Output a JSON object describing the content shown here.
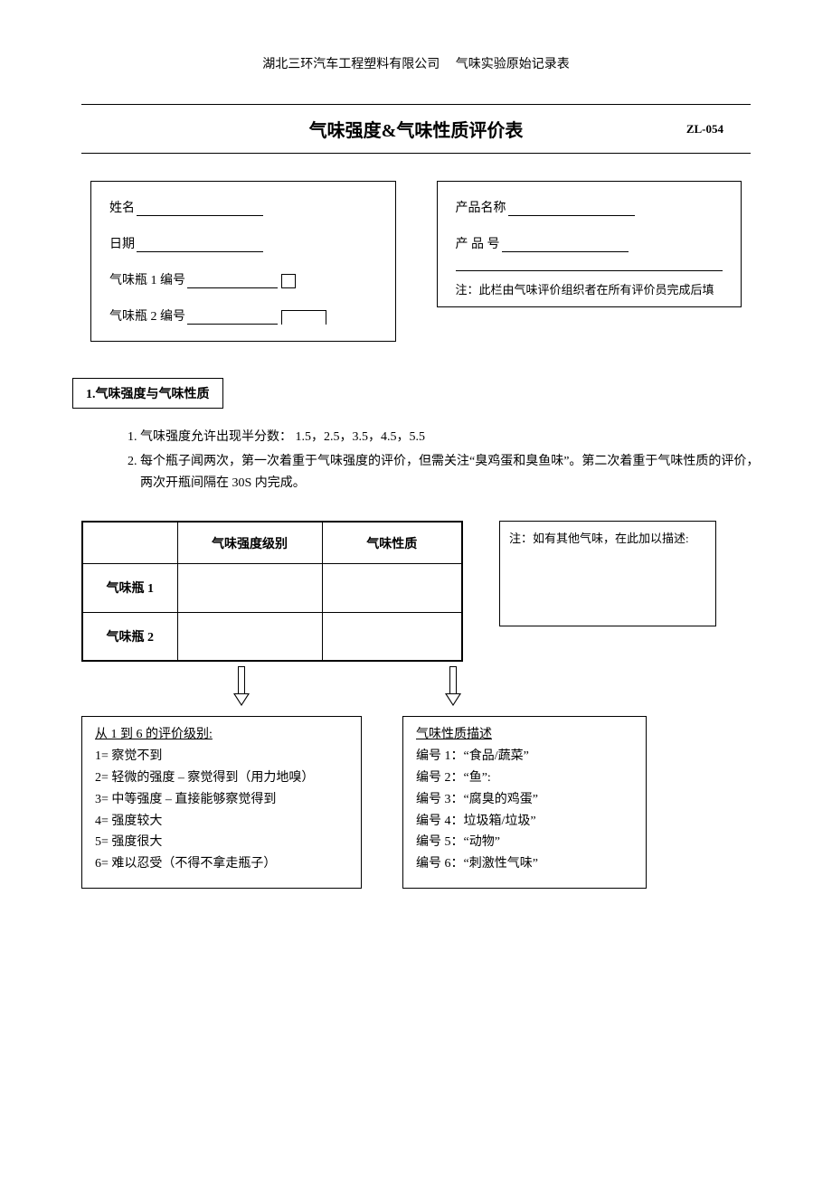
{
  "header": {
    "company": "湖北三环汽车工程塑料有限公司",
    "doc": "气味实验原始记录表"
  },
  "title": {
    "main": "气味强度&气味性质评价表",
    "code": "ZL-054"
  },
  "left_fields": {
    "name_label": "姓名",
    "date_label": "日期",
    "bottle1_label": "气味瓶 1 编号",
    "bottle2_label": "气味瓶 2 编号"
  },
  "right_fields": {
    "product_name_label": "产品名称",
    "product_code_label": "产 品 号",
    "note": "注：此栏由气味评价组织者在所有评价员完成后填"
  },
  "section1": {
    "heading": "1.气味强度与气味性质",
    "instr1": "气味强度允许出现半分数： 1.5，2.5，3.5，4.5，5.5",
    "instr2": "每个瓶子闻两次，第一次着重于气味强度的评价，但需关注“臭鸡蛋和臭鱼味”。第二次着重于气味性质的评价，两次开瓶间隔在 30S 内完成。"
  },
  "eval_table": {
    "col1": "气味强度级别",
    "col2": "气味性质",
    "row1": "气味瓶 1",
    "row2": "气味瓶 2"
  },
  "side_note": {
    "title": "注：如有其他气味，在此加以描述:"
  },
  "intensity_desc": {
    "title": "从 1 到 6 的评价级别:",
    "l1": "1= 察觉不到",
    "l2": "2= 轻微的强度 – 察觉得到（用力地嗅）",
    "l3": "3= 中等强度 – 直接能够察觉得到",
    "l4": "4= 强度较大",
    "l5": "5= 强度很大",
    "l6": "6= 难以忍受（不得不拿走瓶子）"
  },
  "quality_desc": {
    "title": "气味性质描述",
    "l1": "编号 1：“食品/蔬菜”",
    "l2": "编号 2：“鱼”:",
    "l3": "编号 3：“腐臭的鸡蛋”",
    "l4": "编号 4：垃圾箱/垃圾”",
    "l5": "编号 5：“动物”",
    "l6": "编号 6：“刺激性气味”"
  }
}
